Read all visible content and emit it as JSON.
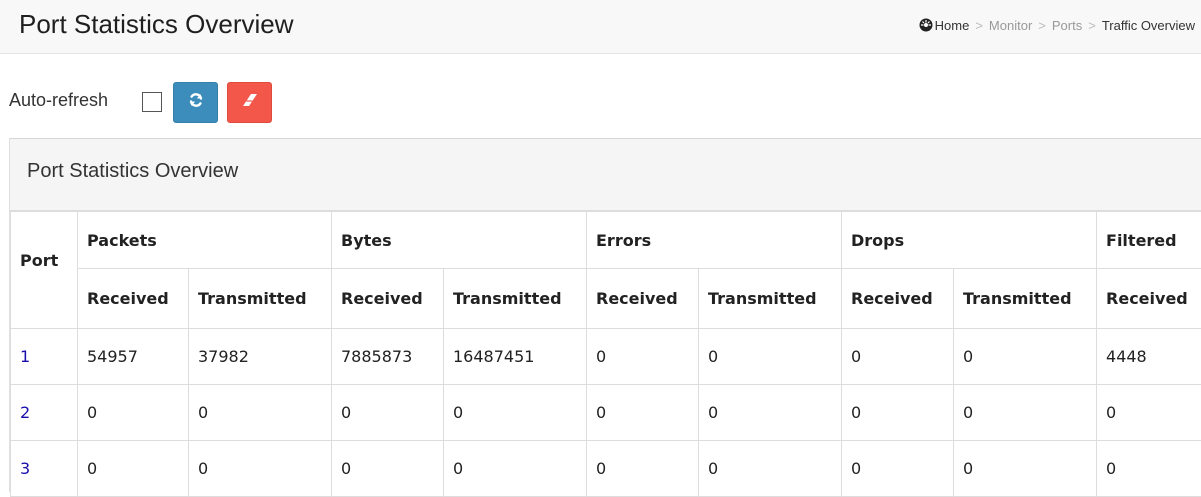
{
  "header": {
    "title": "Port Statistics Overview",
    "breadcrumb": [
      "Home",
      "Monitor",
      "Ports",
      "Traffic Overview"
    ]
  },
  "toolbar": {
    "auto_refresh_label": "Auto-refresh",
    "auto_refresh_checked": false,
    "refresh_icon": "refresh-icon",
    "clear_icon": "eraser-icon"
  },
  "colors": {
    "refresh_button": "#3c8dbc",
    "clear_button": "#f2574a",
    "port_link": "#1a0dab"
  },
  "panel": {
    "title": "Port Statistics Overview"
  },
  "table": {
    "port_header": "Port",
    "groups": [
      "Packets",
      "Bytes",
      "Errors",
      "Drops",
      "Filtered"
    ],
    "subheaders": [
      "Received",
      "Transmitted",
      "Received",
      "Transmitted",
      "Received",
      "Transmitted",
      "Received",
      "Transmitted",
      "Received"
    ],
    "rows": [
      {
        "port": "1",
        "values": [
          "54957",
          "37982",
          "7885873",
          "16487451",
          "0",
          "0",
          "0",
          "0",
          "4448"
        ]
      },
      {
        "port": "2",
        "values": [
          "0",
          "0",
          "0",
          "0",
          "0",
          "0",
          "0",
          "0",
          "0"
        ]
      },
      {
        "port": "3",
        "values": [
          "0",
          "0",
          "0",
          "0",
          "0",
          "0",
          "0",
          "0",
          "0"
        ]
      }
    ]
  }
}
